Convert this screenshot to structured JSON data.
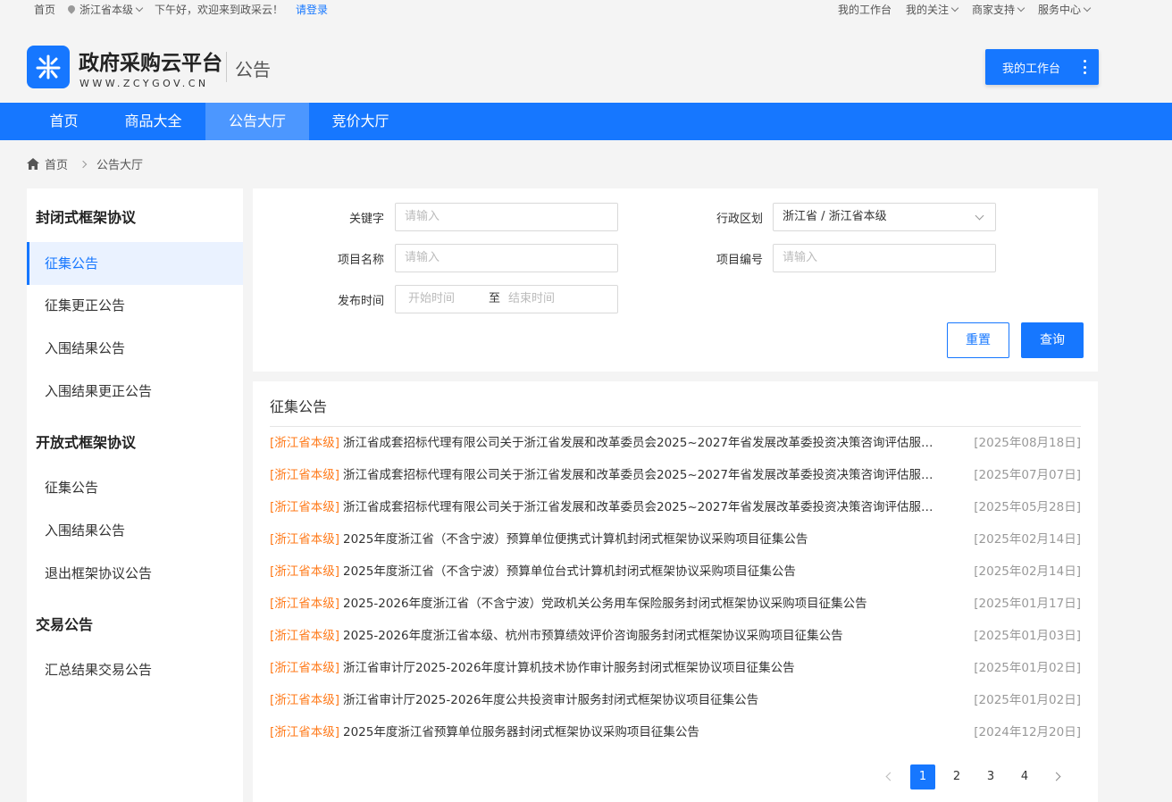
{
  "topbar": {
    "home": "首页",
    "region": "浙江省本级",
    "greeting": "下午好，欢迎来到政采云！",
    "login": "请登录",
    "links": [
      "我的工作台",
      "我的关注",
      "商家支持",
      "服务中心"
    ]
  },
  "header": {
    "brand": "政府采购云平台",
    "url": "WWW.ZCYGOV.CN",
    "section": "公告",
    "workbench_button": "我的工作台"
  },
  "nav": {
    "items": [
      "首页",
      "商品大全",
      "公告大厅",
      "竞价大厅"
    ],
    "active": "公告大厅"
  },
  "breadcrumb": {
    "home": "首页",
    "current": "公告大厅"
  },
  "sidebar": {
    "groups": [
      {
        "title": "封闭式框架协议",
        "items": [
          "征集公告",
          "征集更正公告",
          "入围结果公告",
          "入围结果更正公告"
        ]
      },
      {
        "title": "开放式框架协议",
        "items": [
          "征集公告",
          "入围结果公告",
          "退出框架协议公告"
        ]
      },
      {
        "title": "交易公告",
        "items": [
          "汇总结果交易公告"
        ]
      }
    ],
    "active": "征集公告"
  },
  "search": {
    "keyword_label": "关键字",
    "keyword_placeholder": "请输入",
    "region_label": "行政区划",
    "region_value": "浙江省 / 浙江省本级",
    "project_name_label": "项目名称",
    "project_name_placeholder": "请输入",
    "project_code_label": "项目编号",
    "project_code_placeholder": "请输入",
    "date_label": "发布时间",
    "date_start_placeholder": "开始时间",
    "date_to": "至",
    "date_end_placeholder": "结束时间",
    "reset": "重置",
    "query": "查询"
  },
  "list": {
    "title": "征集公告",
    "rows": [
      {
        "tag": "[浙江省本级]",
        "title": "浙江省成套招标代理有限公司关于浙江省发展和改革委员会2025~2027年省发展改革委投资决策咨询评估服务封闭式框架协议采购项目征集公告",
        "date": "[2025年08月18日]"
      },
      {
        "tag": "[浙江省本级]",
        "title": "浙江省成套招标代理有限公司关于浙江省发展和改革委员会2025~2027年省发展改革委投资决策咨询评估服务封闭式框架协议采购项目征集公告",
        "date": "[2025年07月07日]"
      },
      {
        "tag": "[浙江省本级]",
        "title": "浙江省成套招标代理有限公司关于浙江省发展和改革委员会2025~2027年省发展改革委投资决策咨询评估服务封闭式框架协议采购项目征集公告",
        "date": "[2025年05月28日]"
      },
      {
        "tag": "[浙江省本级]",
        "title": "2025年度浙江省（不含宁波）预算单位便携式计算机封闭式框架协议采购项目征集公告",
        "date": "[2025年02月14日]"
      },
      {
        "tag": "[浙江省本级]",
        "title": "2025年度浙江省（不含宁波）预算单位台式计算机封闭式框架协议采购项目征集公告",
        "date": "[2025年02月14日]"
      },
      {
        "tag": "[浙江省本级]",
        "title": "2025-2026年度浙江省（不含宁波）党政机关公务用车保险服务封闭式框架协议采购项目征集公告",
        "date": "[2025年01月17日]"
      },
      {
        "tag": "[浙江省本级]",
        "title": "2025-2026年度浙江省本级、杭州市预算绩效评价咨询服务封闭式框架协议采购项目征集公告",
        "date": "[2025年01月03日]"
      },
      {
        "tag": "[浙江省本级]",
        "title": "浙江省审计厅2025-2026年度计算机技术协作审计服务封闭式框架协议项目征集公告",
        "date": "[2025年01月02日]"
      },
      {
        "tag": "[浙江省本级]",
        "title": "浙江省审计厅2025-2026年度公共投资审计服务封闭式框架协议项目征集公告",
        "date": "[2025年01月02日]"
      },
      {
        "tag": "[浙江省本级]",
        "title": "2025年度浙江省预算单位服务器封闭式框架协议采购项目征集公告",
        "date": "[2024年12月20日]"
      }
    ]
  },
  "pagination": {
    "pages": [
      "1",
      "2",
      "3",
      "4"
    ],
    "current": "1"
  },
  "colors": {
    "primary": "#1677ff",
    "tag": "#ff7a1a",
    "nav_active": "#4c97ff"
  }
}
